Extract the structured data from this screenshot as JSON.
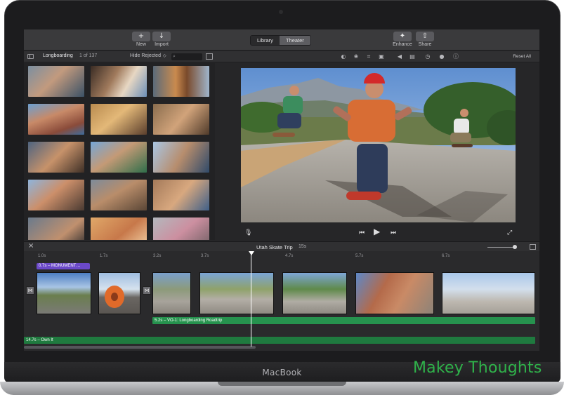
{
  "toolbar": {
    "new_icon": "+",
    "new_label": "New",
    "import_icon": "↓",
    "import_label": "Import",
    "library_tab": "Library",
    "theater_tab": "Theater",
    "enhance_label": "Enhance",
    "share_label": "Share"
  },
  "browser": {
    "event_title": "Longboarding",
    "clip_count": "1 of 137",
    "filter_label": "Hide Rejected",
    "filter_chevron": "◇"
  },
  "adjustments": {
    "reset_label": "Reset All",
    "icons": [
      "color-balance-icon",
      "color-correction-icon",
      "crop-icon",
      "stabilization-icon",
      "volume-icon",
      "noise-reduction-icon",
      "speed-icon",
      "clip-filter-icon",
      "info-icon"
    ]
  },
  "timeline": {
    "project_title": "Utah Skate Trip",
    "project_duration": "15s",
    "ticks": [
      "1.0s",
      "1.7s",
      "3.2s",
      "3.7s",
      "4.7s",
      "5.7s",
      "6.7s"
    ],
    "title_clip_label": "0.7s – MONUMENT…",
    "voiceover_label": "5.2s – VO-1: Longboarding Roadtrip",
    "music_label": "14.7s – Own It"
  },
  "device": {
    "brand": "MacBook"
  },
  "watermark": "Makey Thoughts",
  "colors": {
    "title_purple": "#6b49c9",
    "voiceover_green": "#26924e",
    "music_green": "#1f7a3f",
    "watermark_green": "#2fb24a"
  }
}
